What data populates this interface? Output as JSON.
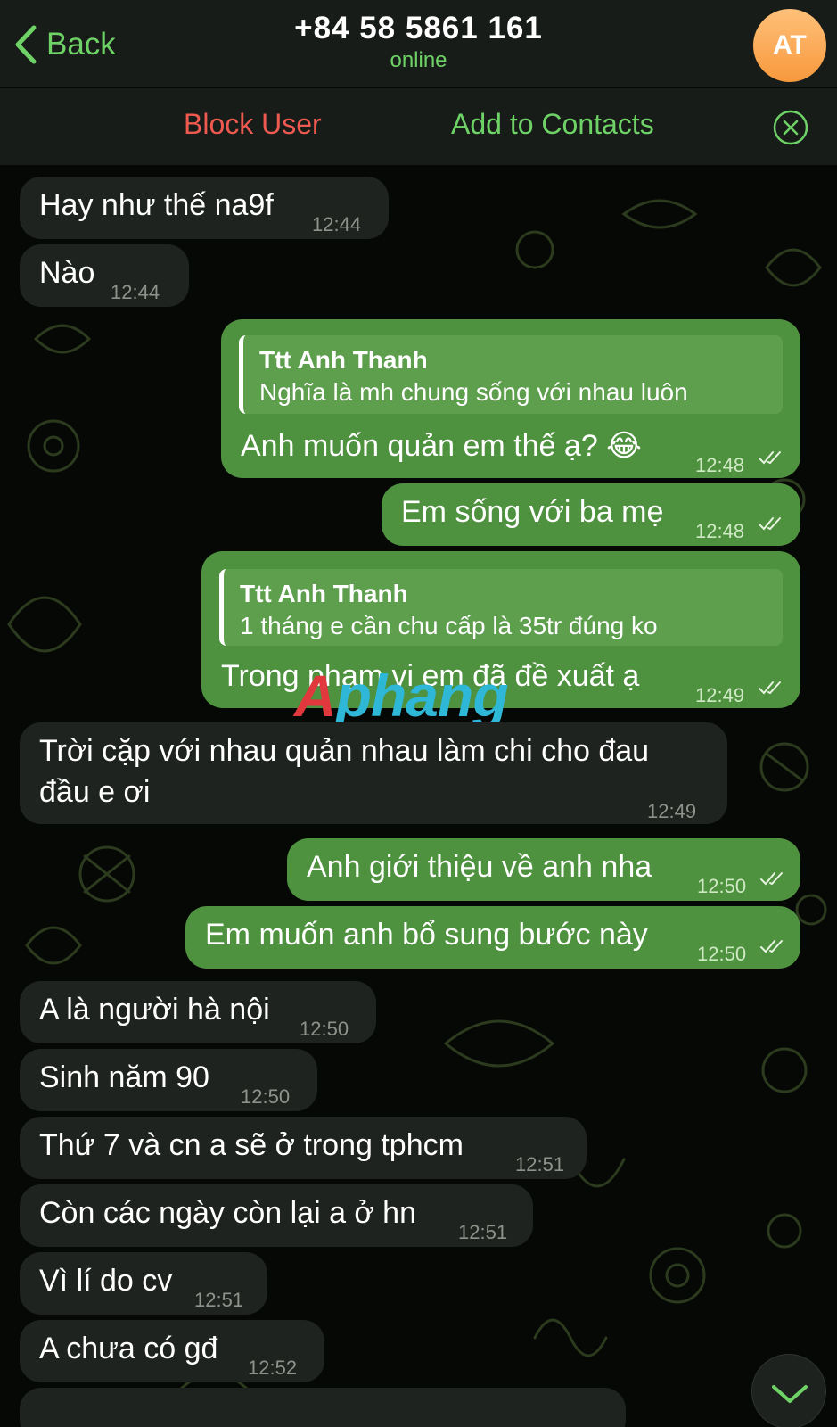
{
  "header": {
    "back_label": "Back",
    "title": "+84 58 5861 161",
    "status": "online",
    "avatar_initials": "AT"
  },
  "actions": {
    "block_label": "Block User",
    "add_label": "Add to Contacts"
  },
  "messages": [
    {
      "dir": "in",
      "text": "Hay như thế na9f",
      "time": "12:44"
    },
    {
      "dir": "in",
      "text": "Nào",
      "time": "12:44"
    },
    {
      "dir": "out",
      "reply_name": "Ttt Anh Thanh",
      "reply_text": "Nghĩa là mh chung sống với nhau luôn",
      "text": "Anh muốn quản em thế ạ? 😂",
      "time": "12:48"
    },
    {
      "dir": "out",
      "text": "Em sống với ba mẹ",
      "time": "12:48"
    },
    {
      "dir": "out",
      "reply_name": "Ttt Anh Thanh",
      "reply_text": "1 tháng e cần chu cấp là 35tr đúng ko",
      "text": "Trong phạm vi em đã đề xuất ạ",
      "time": "12:49"
    },
    {
      "dir": "in",
      "text_line1": "Trời cặp với nhau quản nhau làm chi cho đau",
      "text_line2": "đầu e ơi",
      "time": "12:49"
    },
    {
      "dir": "out",
      "text": "Anh giới thiệu về anh nha",
      "time": "12:50"
    },
    {
      "dir": "out",
      "text": "Em muốn anh bổ sung bước này",
      "time": "12:50"
    },
    {
      "dir": "in",
      "text": "A là người hà nội",
      "time": "12:50"
    },
    {
      "dir": "in",
      "text": "Sinh năm 90",
      "time": "12:50"
    },
    {
      "dir": "in",
      "text": "Thứ 7 và cn a sẽ ở trong tphcm",
      "time": "12:51"
    },
    {
      "dir": "in",
      "text": "Còn các ngày còn lại a ở hn",
      "time": "12:51"
    },
    {
      "dir": "in",
      "text": "Vì lí do cv",
      "time": "12:51"
    },
    {
      "dir": "in",
      "text": "A chưa có gđ",
      "time": "12:52"
    }
  ],
  "watermark": {
    "part1": "A",
    "part2": "phang"
  },
  "colors": {
    "accent_green": "#6ed267",
    "outgoing_bubble": "#4e913e",
    "incoming_bubble": "#1f231f",
    "block_red": "#ef5a50",
    "avatar_orange": "#f7993d"
  }
}
